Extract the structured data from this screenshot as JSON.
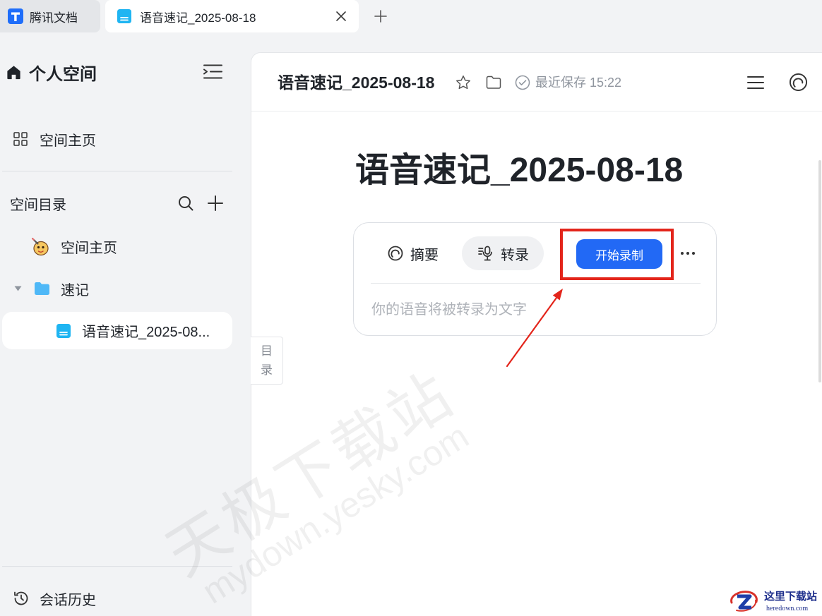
{
  "window": {
    "tabs": [
      {
        "label": "腾讯文档",
        "active": false
      },
      {
        "label": "语音速记_2025-08-18",
        "active": true
      }
    ]
  },
  "sidebar": {
    "space_title": "个人空间",
    "home_link": "空间主页",
    "directory_title": "空间目录",
    "tree": [
      {
        "label": "空间主页",
        "icon": "space-home-emoji-icon"
      },
      {
        "label": "速记",
        "icon": "folder-icon",
        "expanded": true
      },
      {
        "label": "语音速记_2025-08...",
        "icon": "doc-icon",
        "selected": true
      }
    ],
    "history_link": "会话历史"
  },
  "header": {
    "doc_title": "语音速记_2025-08-18",
    "save_status": "最近保存 15:22"
  },
  "document": {
    "title": "语音速记_2025-08-18",
    "toc_tab": "目录",
    "recorder": {
      "tabs": [
        {
          "label": "摘要",
          "active": false
        },
        {
          "label": "转录",
          "active": true
        }
      ],
      "start_button": "开始录制",
      "placeholder": "你的语音将被转录为文字"
    }
  },
  "watermark": {
    "text": "天极下载站",
    "url": "mydown.yesky.com"
  },
  "corner_logo": {
    "name": "这里下载站",
    "url": "heredown.com"
  },
  "icons": [
    "tencent-docs-logo-icon",
    "doc-icon",
    "close-icon",
    "plus-icon",
    "home-icon",
    "sidebar-toggle-icon",
    "grid-icon",
    "search-icon",
    "add-icon",
    "space-home-emoji-icon",
    "caret-down-icon",
    "folder-icon",
    "history-icon",
    "star-icon",
    "folder-outline-icon",
    "check-circle-icon",
    "menu-icon",
    "ai-assistant-icon",
    "summary-icon",
    "transcript-icon",
    "more-icon"
  ],
  "colors": {
    "accent": "#2269f5",
    "annotation": "#e3251b",
    "doc_icon": "#1fb5f2",
    "folder_icon": "#4fb8f7",
    "app_bg": "#f2f3f5",
    "selected_bg": "#ffffff"
  }
}
